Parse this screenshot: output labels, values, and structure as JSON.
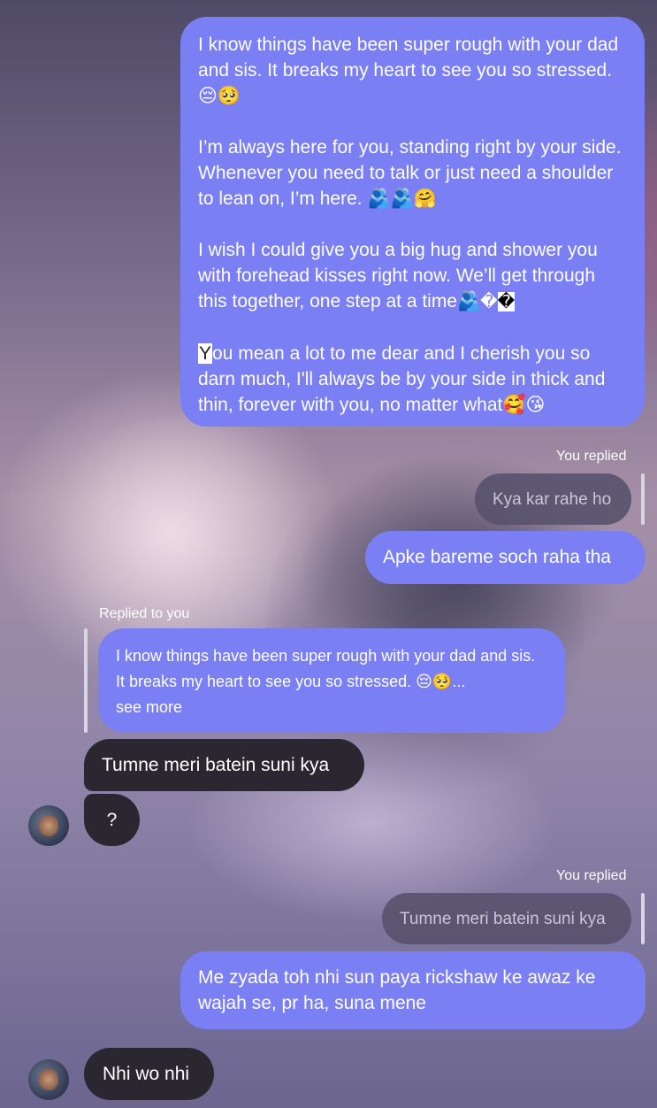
{
  "messages": {
    "long": {
      "p1": "I know things have been super rough with your dad and sis. It breaks my heart to see you so stressed. 😔🥺",
      "p2": "I’m always here for you, standing right by your side. Whenever you need to talk or just need a shoulder to lean on, I’m here. 🫂🫂🤗",
      "p3": "I wish I could give you a big hug and shower you with forehead kisses right now. We’ll get through this together, one step at a time🫂",
      "p3_tail": "�",
      "p4_first": "Y",
      "p4_rest": "ou mean a lot to me dear and I cherish you so darn much, I'll always be by your side in thick and thin, forever with you, no matter what🥰😘"
    },
    "reply1": {
      "label": "You replied",
      "quoted": "Kya kar rahe ho",
      "text": "Apke bareme soch raha tha"
    },
    "reply2": {
      "label": "Replied to you",
      "quoted": "I know things have been super rough with your dad and sis. It breaks my heart to see you so stressed. 😔🥺...",
      "see_more": "see more",
      "text": "Tumne meri batein suni kya",
      "followup": "?"
    },
    "reply3": {
      "label": "You replied",
      "quoted": "Tumne meri batein suni kya",
      "text": "Me zyada toh nhi sun paya rickshaw ke awaz ke wajah se, pr ha, suna mene"
    },
    "last": {
      "text": "Nhi wo nhi"
    }
  }
}
